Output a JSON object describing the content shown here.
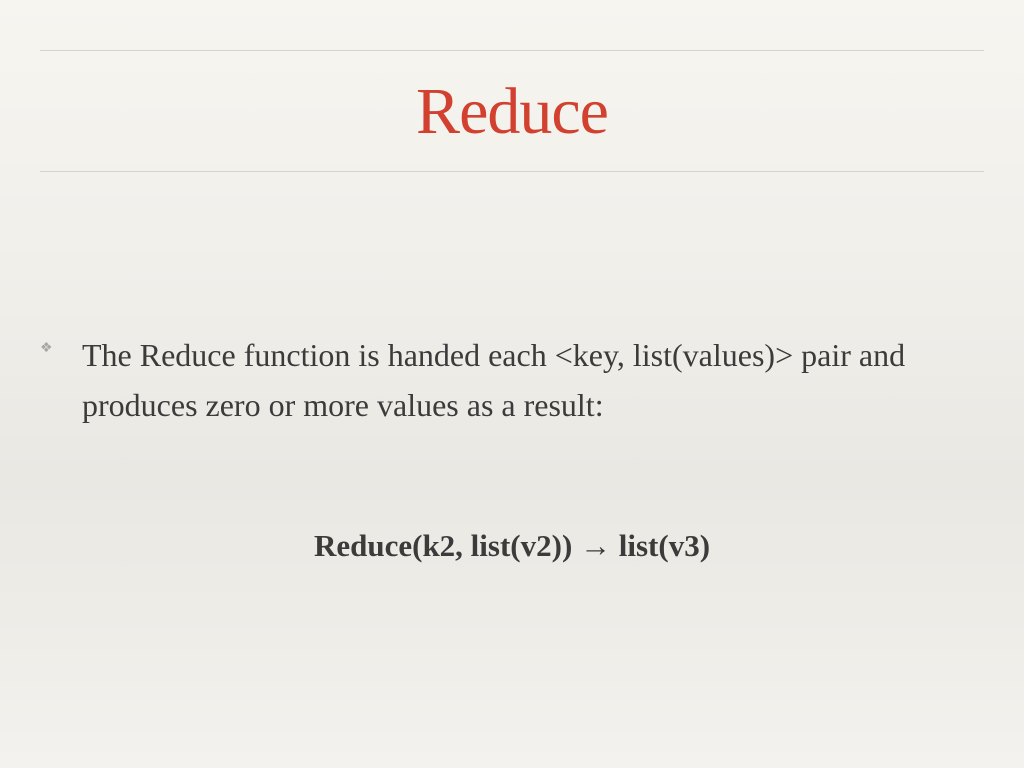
{
  "slide": {
    "title": "Reduce",
    "bullet_marker": "❖",
    "bullet_text": "The Reduce function is handed each <key, list(values)> pair and produces zero or more values as a result:",
    "formula": "Reduce(k2, list(v2)) → list(v3)"
  },
  "colors": {
    "title": "#d2412f",
    "body_text": "#3b3b3b",
    "rule": "#d6d3cc",
    "background": "#f1efea"
  }
}
